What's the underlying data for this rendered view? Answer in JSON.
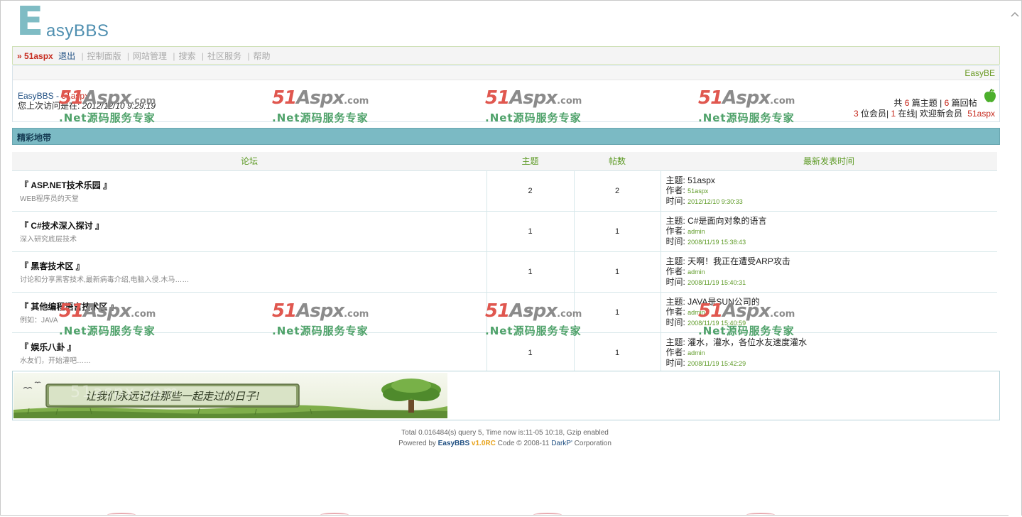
{
  "logo": {
    "first_letter": "E",
    "rest": "asyBBS"
  },
  "nav": {
    "raquo": "»",
    "username": "51aspx",
    "logout": "退出",
    "links": [
      "控制面版",
      "网站管理",
      "搜索",
      "社区服务",
      "帮助"
    ]
  },
  "info": {
    "header_right": "EasyBE",
    "site_name": "EasyBBS",
    "dash": " - ",
    "user": "51aspx",
    "last_visit_label": "您上次访问是在: ",
    "last_visit_time": "2012/12/10 9:29:19",
    "stats": {
      "total_prefix": "共",
      "topics": "6",
      "topics_label": "篇主题",
      "sep": "|",
      "replies": "6",
      "replies_label": "篇回帖",
      "members": "3",
      "members_label": "位会员|",
      "online": "1",
      "online_label": "在线|",
      "welcome_label": "欢迎新会员",
      "new_member": "51aspx"
    }
  },
  "section": {
    "title": "精彩地带"
  },
  "table": {
    "headers": [
      "论坛",
      "主题",
      "帖数",
      "最新发表时间"
    ],
    "rows": [
      {
        "name": "『 ASP.NET技术乐园 』",
        "desc": "WEB程序员的天堂",
        "topics": "2",
        "posts": "2",
        "last_subject": "主题: 51aspx",
        "last_author_label": "作者: ",
        "last_author": "51aspx",
        "last_time_label": "时间: ",
        "last_time": "2012/12/10 9:30:33"
      },
      {
        "name": "『 C#技术深入探讨 』",
        "desc": "深入研究底层技术",
        "topics": "1",
        "posts": "1",
        "last_subject": "主题: C#是面向对象的语言",
        "last_author_label": "作者: ",
        "last_author": "admin",
        "last_time_label": "时间: ",
        "last_time": "2008/11/19 15:38:43"
      },
      {
        "name": "『 黑客技术区 』",
        "desc": "讨论和分享黑客技术,最新病毒介绍,电脑入侵.木马……",
        "topics": "1",
        "posts": "1",
        "last_subject": "主题: 天啊！我正在遭受ARP攻击",
        "last_author_label": "作者: ",
        "last_author": "admin",
        "last_time_label": "时间: ",
        "last_time": "2008/11/19 15:40:31"
      },
      {
        "name": "『 其他编程语言技术区 』",
        "desc": "例如：JAVA",
        "topics": "1",
        "posts": "1",
        "last_subject": "主题: JAVA是SUN公司的",
        "last_author_label": "作者: ",
        "last_author": "admin",
        "last_time_label": "时间: ",
        "last_time": "2008/11/19 15:40:59"
      },
      {
        "name": "『 娱乐八卦 』",
        "desc": "水友们，开始灌吧……",
        "topics": "1",
        "posts": "1",
        "last_subject": "主题: 灌水，灌水，各位水友速度灌水",
        "last_author_label": "作者: ",
        "last_author": "admin",
        "last_time_label": "时间: ",
        "last_time": "2008/11/19 15:42:29"
      }
    ]
  },
  "banner": {
    "text": "让我们永远记住那些一起走过的日子!",
    "watermark_text": "51aspx.com"
  },
  "footer": {
    "line1": "Total 0.016484(s) query 5, Time now is:11-05 10:18, Gzip enabled",
    "powered_by": "Powered by ",
    "brand": "EasyBBS",
    "version": "v1.0RC",
    "code": " Code © 2008-11 ",
    "company": "DarkP'",
    "corp": " Corporation"
  },
  "watermark": {
    "logo_a": "51",
    "logo_b": "Aspx",
    "logo_c": ".com",
    "sub": ".Net源码服务专家"
  },
  "colors": {
    "accent": "#7bbac4",
    "link": "#1f4f82",
    "highlight": "#c62b1f",
    "green": "#5d9a25"
  },
  "icons": {
    "apple": "apple-icon",
    "scroll_up": "chevron-up-icon",
    "raquo": "raquo-icon"
  }
}
